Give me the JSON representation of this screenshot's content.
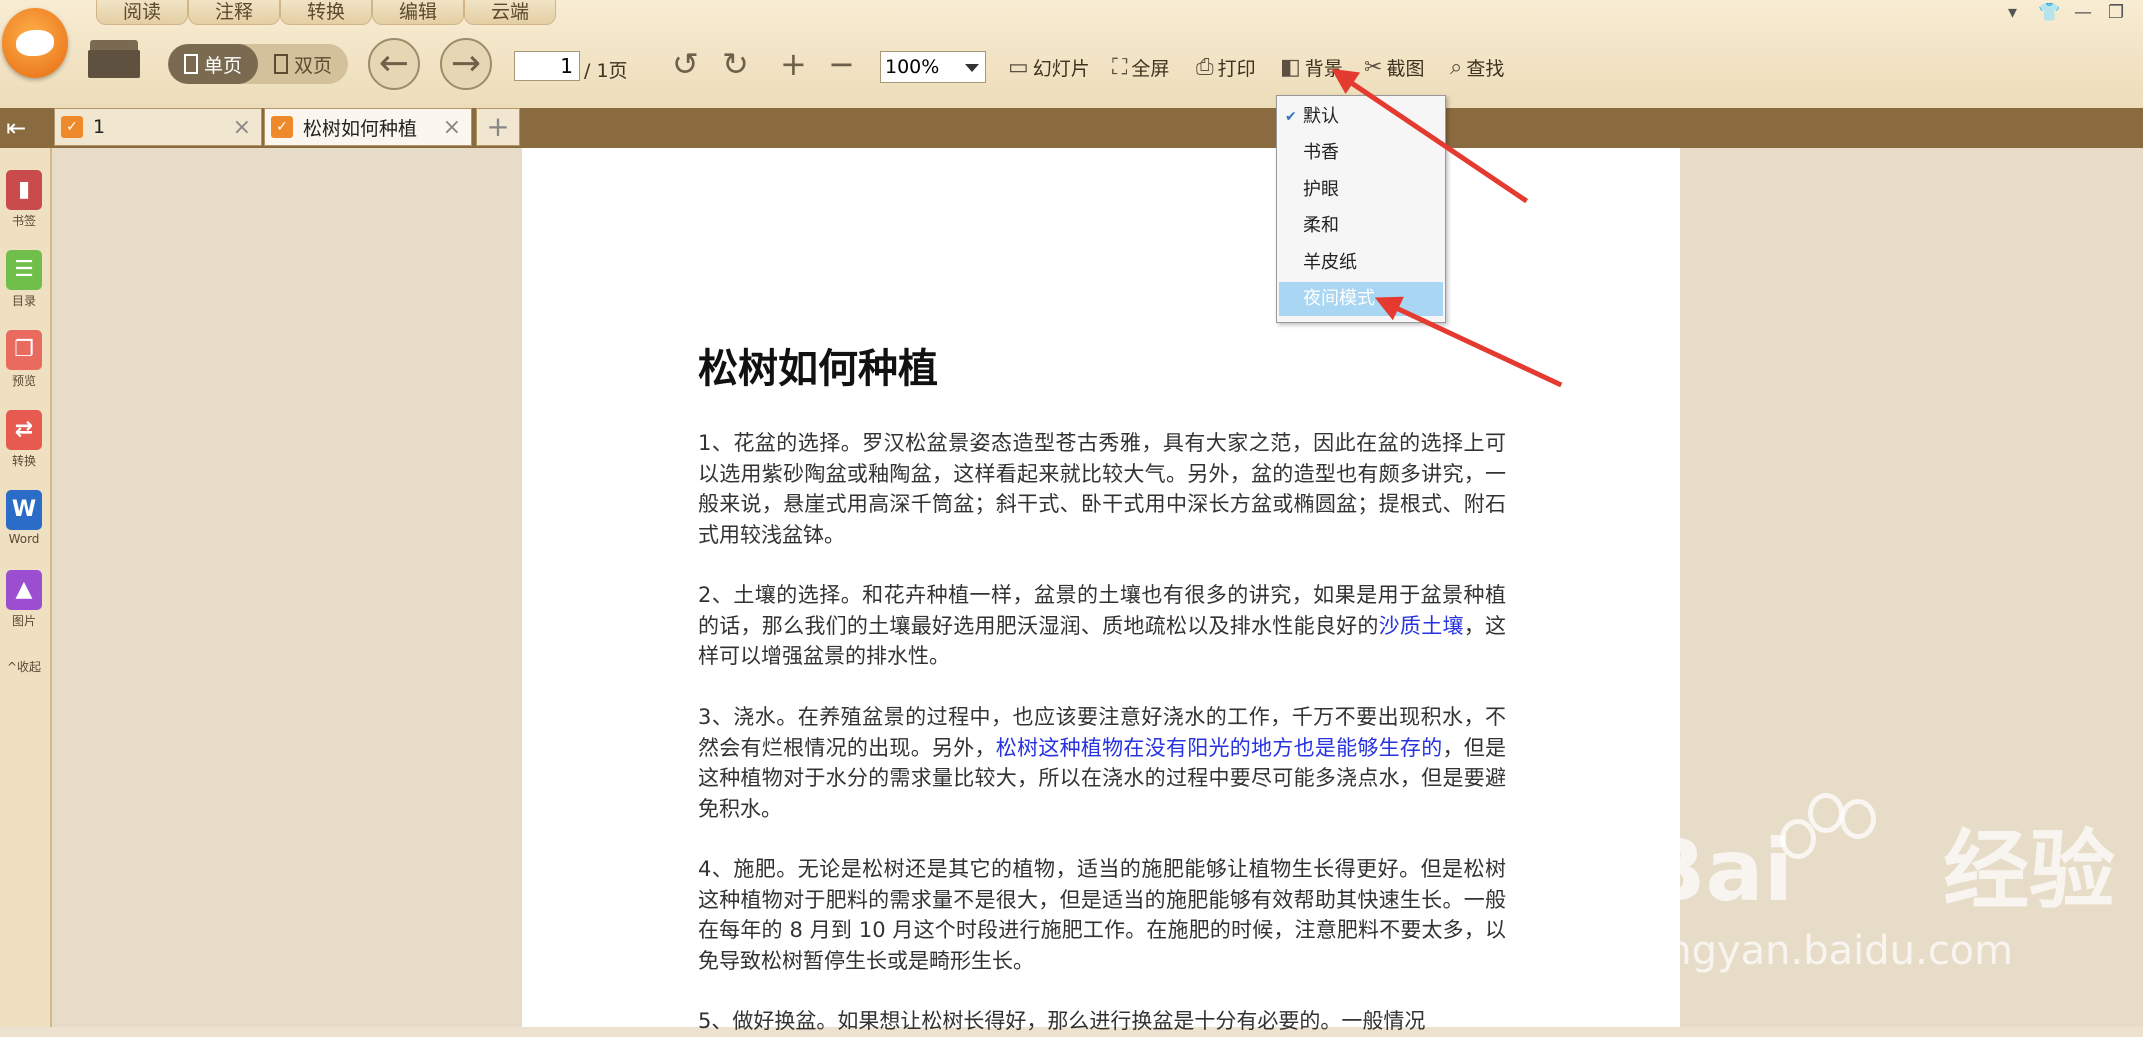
{
  "menu_tabs": [
    "阅读",
    "注释",
    "转换",
    "编辑",
    "云端"
  ],
  "toolbar": {
    "single_page": "单页",
    "double_page": "双页",
    "page_current": "1",
    "page_total": "/ 1页",
    "zoom": "100%",
    "slideshow": "幻灯片",
    "fullscreen": "全屏",
    "print": "打印",
    "background": "背景",
    "screenshot": "截图",
    "search": "查找"
  },
  "tabs": [
    {
      "label": "1"
    },
    {
      "label": "松树如何种植"
    }
  ],
  "sidebar": {
    "items": [
      {
        "label": "书签",
        "icon": "bookmark-icon",
        "color": "#c94b4b"
      },
      {
        "label": "目录",
        "icon": "toc-icon",
        "color": "#6fbf4a"
      },
      {
        "label": "预览",
        "icon": "preview-icon",
        "color": "#e96a5f"
      },
      {
        "label": "转换",
        "icon": "convert-icon",
        "color": "#e65a4f"
      },
      {
        "label": "Word",
        "icon": "word-icon",
        "color": "#2a6cc7"
      },
      {
        "label": "图片",
        "icon": "image-icon",
        "color": "#9b4fd0"
      }
    ],
    "collapse": "收起"
  },
  "background_menu": {
    "items": [
      "默认",
      "书香",
      "护眼",
      "柔和",
      "羊皮纸",
      "夜间模式"
    ],
    "checked": "默认",
    "highlighted": "夜间模式"
  },
  "document": {
    "title": "松树如何种植",
    "p1": "1、花盆的选择。罗汉松盆景姿态造型苍古秀雅，具有大家之范，因此在盆的选择上可以选用紫砂陶盆或釉陶盆，这样看起来就比较大气。另外，盆的造型也有颇多讲究，一般来说，悬崖式用高深千筒盆；斜干式、卧干式用中深长方盆或椭圆盆；提根式、附石式用较浅盆钵。",
    "p2a": "2、土壤的选择。和花卉种植一样，盆景的土壤也有很多的讲究，如果是用于盆景种植的话，那么我们的土壤最好选用肥沃湿润、质地疏松以及排水性能良好的",
    "p2link": "沙质土壤",
    "p2b": "，这样可以增强盆景的排水性。",
    "p3a": "3、浇水。在养殖盆景的过程中，也应该要注意好浇水的工作，千万不要出现积水，不然会有烂根情况的出现。另外，",
    "p3link": "松树这种植物在没有阳光的地方也是能够生存的",
    "p3b": "，但是这种植物对于水分的需求量比较大，所以在浇水的过程中要尽可能多浇点水，但是要避免积水。",
    "p4": "4、施肥。无论是松树还是其它的植物，适当的施肥能够让植物生长得更好。但是松树这种植物对于肥料的需求量不是很大，但是适当的施肥能够有效帮助其快速生长。一般在每年的 8 月到 10 月这个时段进行施肥工作。在施肥的时候，注意肥料不要太多，以免导致松树暂停生长或是畸形生长。",
    "p5": "5、做好换盆。如果想让松树长得好，那么进行换盆是十分有必要的。一般情况"
  },
  "watermark": {
    "brand": "Bai",
    "brand_cn": "经验",
    "url": "jingyan.baidu.com"
  }
}
